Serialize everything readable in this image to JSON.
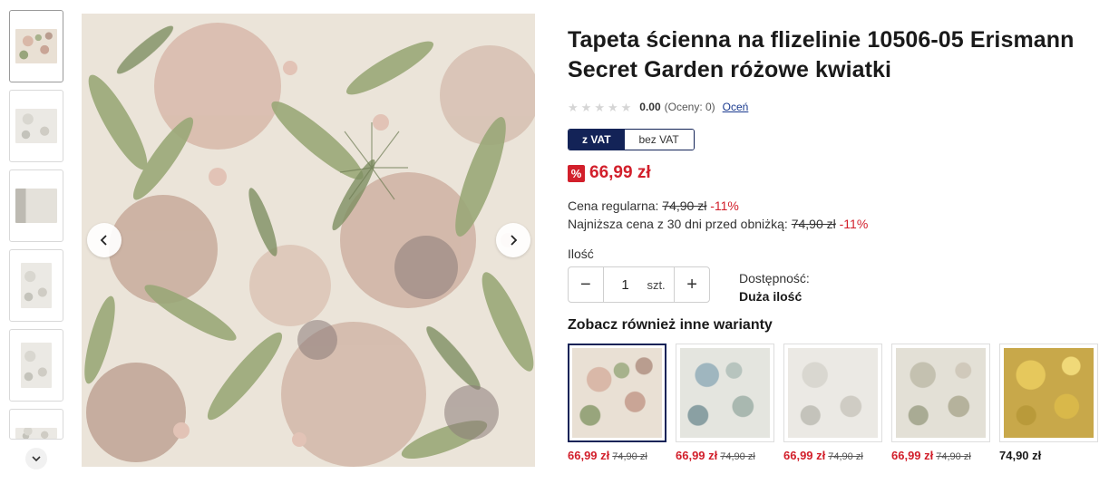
{
  "gallery": {
    "thumbnails": [
      {
        "texture": "tex-pink",
        "active": true
      },
      {
        "texture": "tex-grey",
        "active": false
      },
      {
        "texture": "tex-side",
        "active": false
      },
      {
        "texture": "tex-grey",
        "active": false
      },
      {
        "texture": "tex-grey",
        "active": false
      },
      {
        "texture": "tex-grey",
        "active": false
      }
    ],
    "scroll_down_icon": "chevron-down-icon",
    "prev_icon": "chevron-left-icon",
    "next_icon": "chevron-right-icon"
  },
  "product": {
    "title": "Tapeta ścienna na flizelinie 10506-05 Erismann Secret Garden różowe kwiatki",
    "rating": {
      "stars": 0,
      "max_stars": 5,
      "score": "0.00",
      "count_text": "(Oceny: 0)",
      "rate_link": "Oceń"
    },
    "vat": {
      "with_vat": "z VAT",
      "without_vat": "bez VAT",
      "selected": "with_vat"
    },
    "promo_badge": "%",
    "price": "66,99 zł",
    "regular": {
      "label": "Cena regularna:",
      "old_price": "74,90 zł",
      "discount": "-11%"
    },
    "lowest": {
      "label": "Najniższa cena z 30 dni przed obniżką:",
      "old_price": "74,90 zł",
      "discount": "-11%"
    },
    "quantity": {
      "label": "Ilość",
      "value": "1",
      "unit": "szt.",
      "minus": "−",
      "plus": "+"
    },
    "availability": {
      "label": "Dostępność:",
      "value": "Duża ilość"
    }
  },
  "variants": {
    "title": "Zobacz również inne warianty",
    "items": [
      {
        "texture": "tex-pink",
        "price": "66,99 zł",
        "old_price": "74,90 zł",
        "selected": true
      },
      {
        "texture": "tex-blue",
        "price": "66,99 zł",
        "old_price": "74,90 zł",
        "selected": false
      },
      {
        "texture": "tex-grey",
        "price": "66,99 zł",
        "old_price": "74,90 zł",
        "selected": false
      },
      {
        "texture": "tex-sage",
        "price": "66,99 zł",
        "old_price": "74,90 zł",
        "selected": false
      },
      {
        "texture": "tex-yellow",
        "price": "74,90 zł",
        "old_price": "",
        "selected": false
      }
    ]
  },
  "colors": {
    "accent_navy": "#132357",
    "sale_red": "#d21f2b"
  }
}
